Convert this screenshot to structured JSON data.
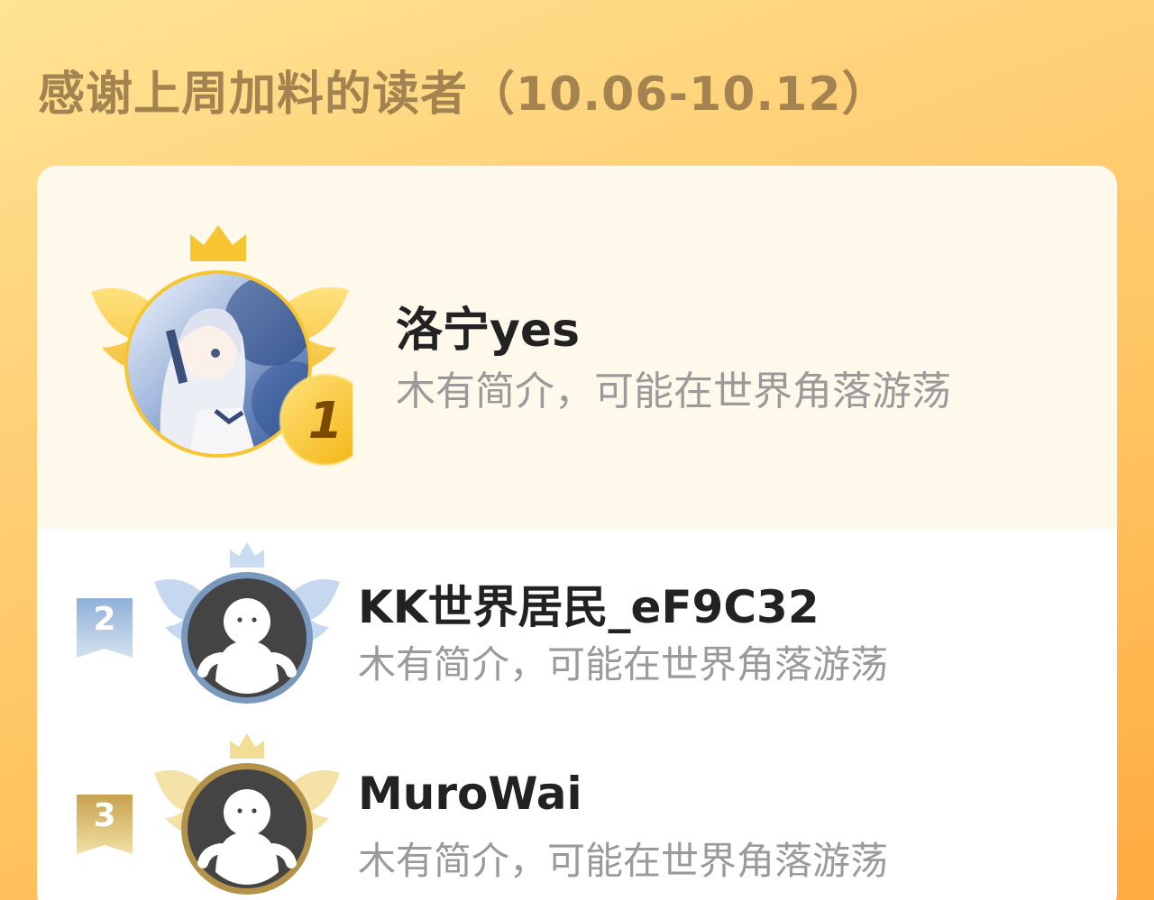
{
  "page": {
    "title": "感谢上周加料的读者（10.06-10.12）"
  },
  "colors": {
    "gold": "#f7c531",
    "silver_blue": "#7a98bd",
    "bronze": "#b3934a",
    "title": "#a38350",
    "bio": "#9a9a9a"
  },
  "readers": [
    {
      "rank": "1",
      "name": "洛宁yes",
      "bio": "木有简介，可能在世界角落游荡",
      "avatar": "anime-girl-avatar"
    },
    {
      "rank": "2",
      "name": "KK世界居民_eF9C32",
      "bio": "木有简介，可能在世界角落游荡",
      "avatar": "default-avatar"
    },
    {
      "rank": "3",
      "name": "MuroWai",
      "bio": "木有简介，可能在世界角落游荡",
      "avatar": "default-avatar"
    }
  ]
}
